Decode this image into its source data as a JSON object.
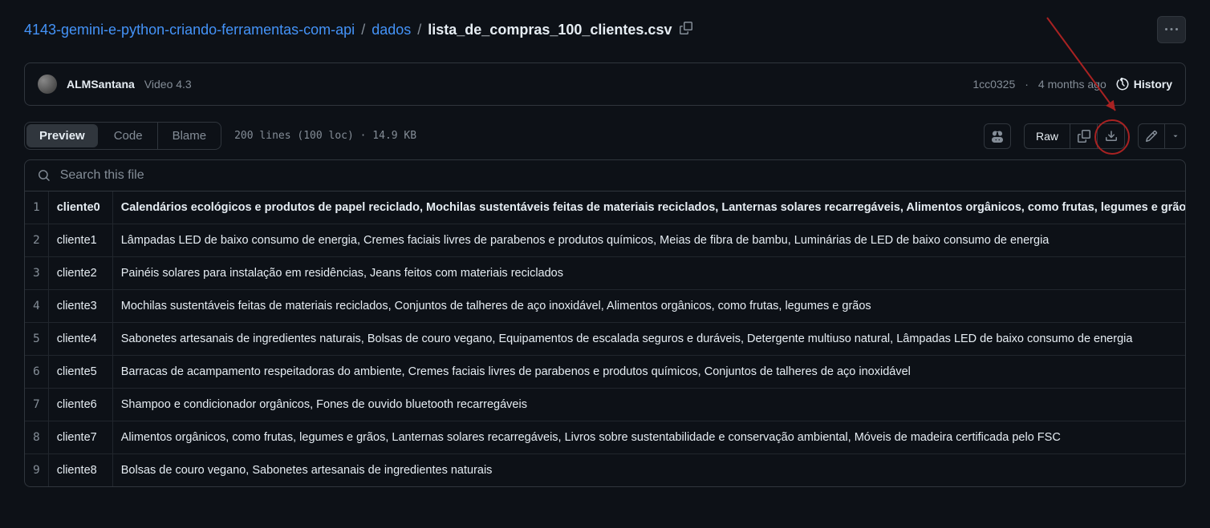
{
  "breadcrumb": {
    "repo": "4143-gemini-e-python-criando-ferramentas-com-api",
    "dir": "dados",
    "file": "lista_de_compras_100_clientes.csv"
  },
  "commit": {
    "author": "ALMSantana",
    "message": "Video 4.3",
    "sha": "1cc0325",
    "sep": " · ",
    "age": "4 months ago",
    "history_label": "History"
  },
  "toolbar": {
    "tabs": {
      "preview": "Preview",
      "code": "Code",
      "blame": "Blame"
    },
    "meta": "200 lines (100 loc) · 14.9 KB",
    "raw": "Raw"
  },
  "search": {
    "placeholder": "Search this file"
  },
  "rows": [
    {
      "n": "1",
      "key": "cliente0",
      "val": "Calendários ecológicos e produtos de papel reciclado, Mochilas sustentáveis feitas de materiais reciclados, Lanternas solares recarregáveis, Alimentos orgânicos, como frutas, legumes e grãos,"
    },
    {
      "n": "2",
      "key": "cliente1",
      "val": "Lâmpadas LED de baixo consumo de energia, Cremes faciais livres de parabenos e produtos químicos, Meias de fibra de bambu, Luminárias de LED de baixo consumo de energia"
    },
    {
      "n": "3",
      "key": "cliente2",
      "val": "Painéis solares para instalação em residências, Jeans feitos com materiais reciclados"
    },
    {
      "n": "4",
      "key": "cliente3",
      "val": "Mochilas sustentáveis feitas de materiais reciclados, Conjuntos de talheres de aço inoxidável, Alimentos orgânicos, como frutas, legumes e grãos"
    },
    {
      "n": "5",
      "key": "cliente4",
      "val": "Sabonetes artesanais de ingredientes naturais, Bolsas de couro vegano, Equipamentos de escalada seguros e duráveis, Detergente multiuso natural, Lâmpadas LED de baixo consumo de energia"
    },
    {
      "n": "6",
      "key": "cliente5",
      "val": "Barracas de acampamento respeitadoras do ambiente, Cremes faciais livres de parabenos e produtos químicos, Conjuntos de talheres de aço inoxidável"
    },
    {
      "n": "7",
      "key": "cliente6",
      "val": "Shampoo e condicionador orgânicos, Fones de ouvido bluetooth recarregáveis"
    },
    {
      "n": "8",
      "key": "cliente7",
      "val": "Alimentos orgânicos, como frutas, legumes e grãos, Lanternas solares recarregáveis, Livros sobre sustentabilidade e conservação ambiental, Móveis de madeira certificada pelo FSC"
    },
    {
      "n": "9",
      "key": "cliente8",
      "val": "Bolsas de couro vegano, Sabonetes artesanais de ingredientes naturais"
    }
  ]
}
